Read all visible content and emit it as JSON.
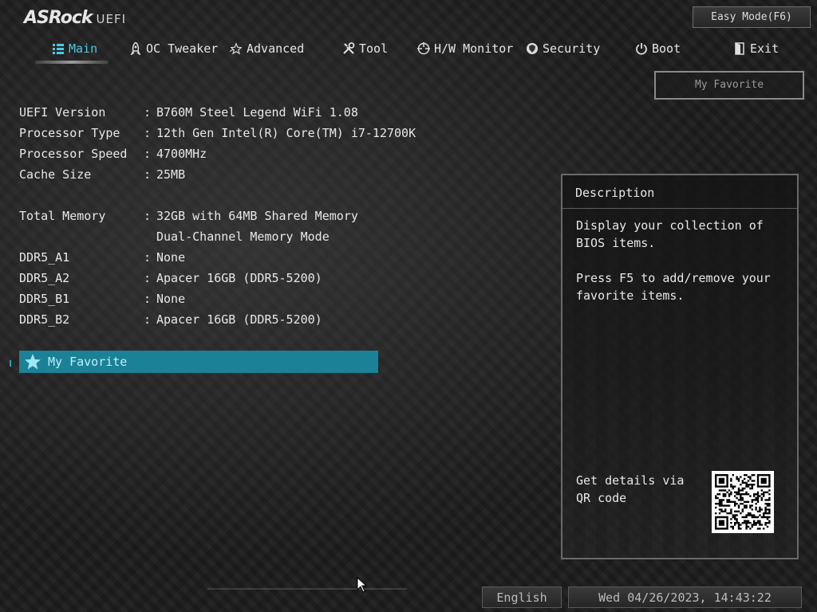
{
  "brand": {
    "name": "ASRock",
    "suffix": "UEFI"
  },
  "easy_mode_label": "Easy Mode(F6)",
  "tabs": [
    {
      "label": "Main",
      "icon": "list-icon",
      "active": true
    },
    {
      "label": "OC Tweaker",
      "icon": "rocket-icon",
      "active": false
    },
    {
      "label": "Advanced",
      "icon": "star-outline-icon",
      "active": false
    },
    {
      "label": "Tool",
      "icon": "tools-icon",
      "active": false
    },
    {
      "label": "H/W Monitor",
      "icon": "crosshair-icon",
      "active": false
    },
    {
      "label": "Security",
      "icon": "shield-icon",
      "active": false
    },
    {
      "label": "Boot",
      "icon": "power-icon",
      "active": false
    },
    {
      "label": "Exit",
      "icon": "exit-door-icon",
      "active": false
    }
  ],
  "my_favorite_button": "My Favorite",
  "info": {
    "uefi_version": {
      "label": "UEFI Version",
      "value": "B760M Steel Legend WiFi 1.08"
    },
    "processor_type": {
      "label": "Processor Type",
      "value": "12th Gen Intel(R) Core(TM) i7-12700K"
    },
    "processor_speed": {
      "label": "Processor Speed",
      "value": "4700MHz"
    },
    "cache_size": {
      "label": "Cache Size",
      "value": "25MB"
    },
    "total_memory": {
      "label": "Total Memory",
      "value": "32GB with 64MB Shared Memory",
      "value2": "Dual-Channel Memory Mode"
    },
    "ddr5_a1": {
      "label": "DDR5_A1",
      "value": "None"
    },
    "ddr5_a2": {
      "label": "DDR5_A2",
      "value": "Apacer 16GB (DDR5-5200)"
    },
    "ddr5_b1": {
      "label": "DDR5_B1",
      "value": "None"
    },
    "ddr5_b2": {
      "label": "DDR5_B2",
      "value": "Apacer 16GB (DDR5-5200)"
    }
  },
  "colon": ":",
  "favorite_item": {
    "label": "My Favorite",
    "icon": "star-icon"
  },
  "description": {
    "title": "Description",
    "line1": "Display your collection of BIOS items.",
    "line2": "Press F5 to add/remove your favorite items.",
    "qr_label": "Get details via QR code"
  },
  "footer": {
    "language": "English",
    "datetime": "Wed 04/26/2023, 14:43:22"
  },
  "colors": {
    "accent": "#4ec8e0",
    "highlight": "#1b8196",
    "background": "#1c1c1c"
  }
}
